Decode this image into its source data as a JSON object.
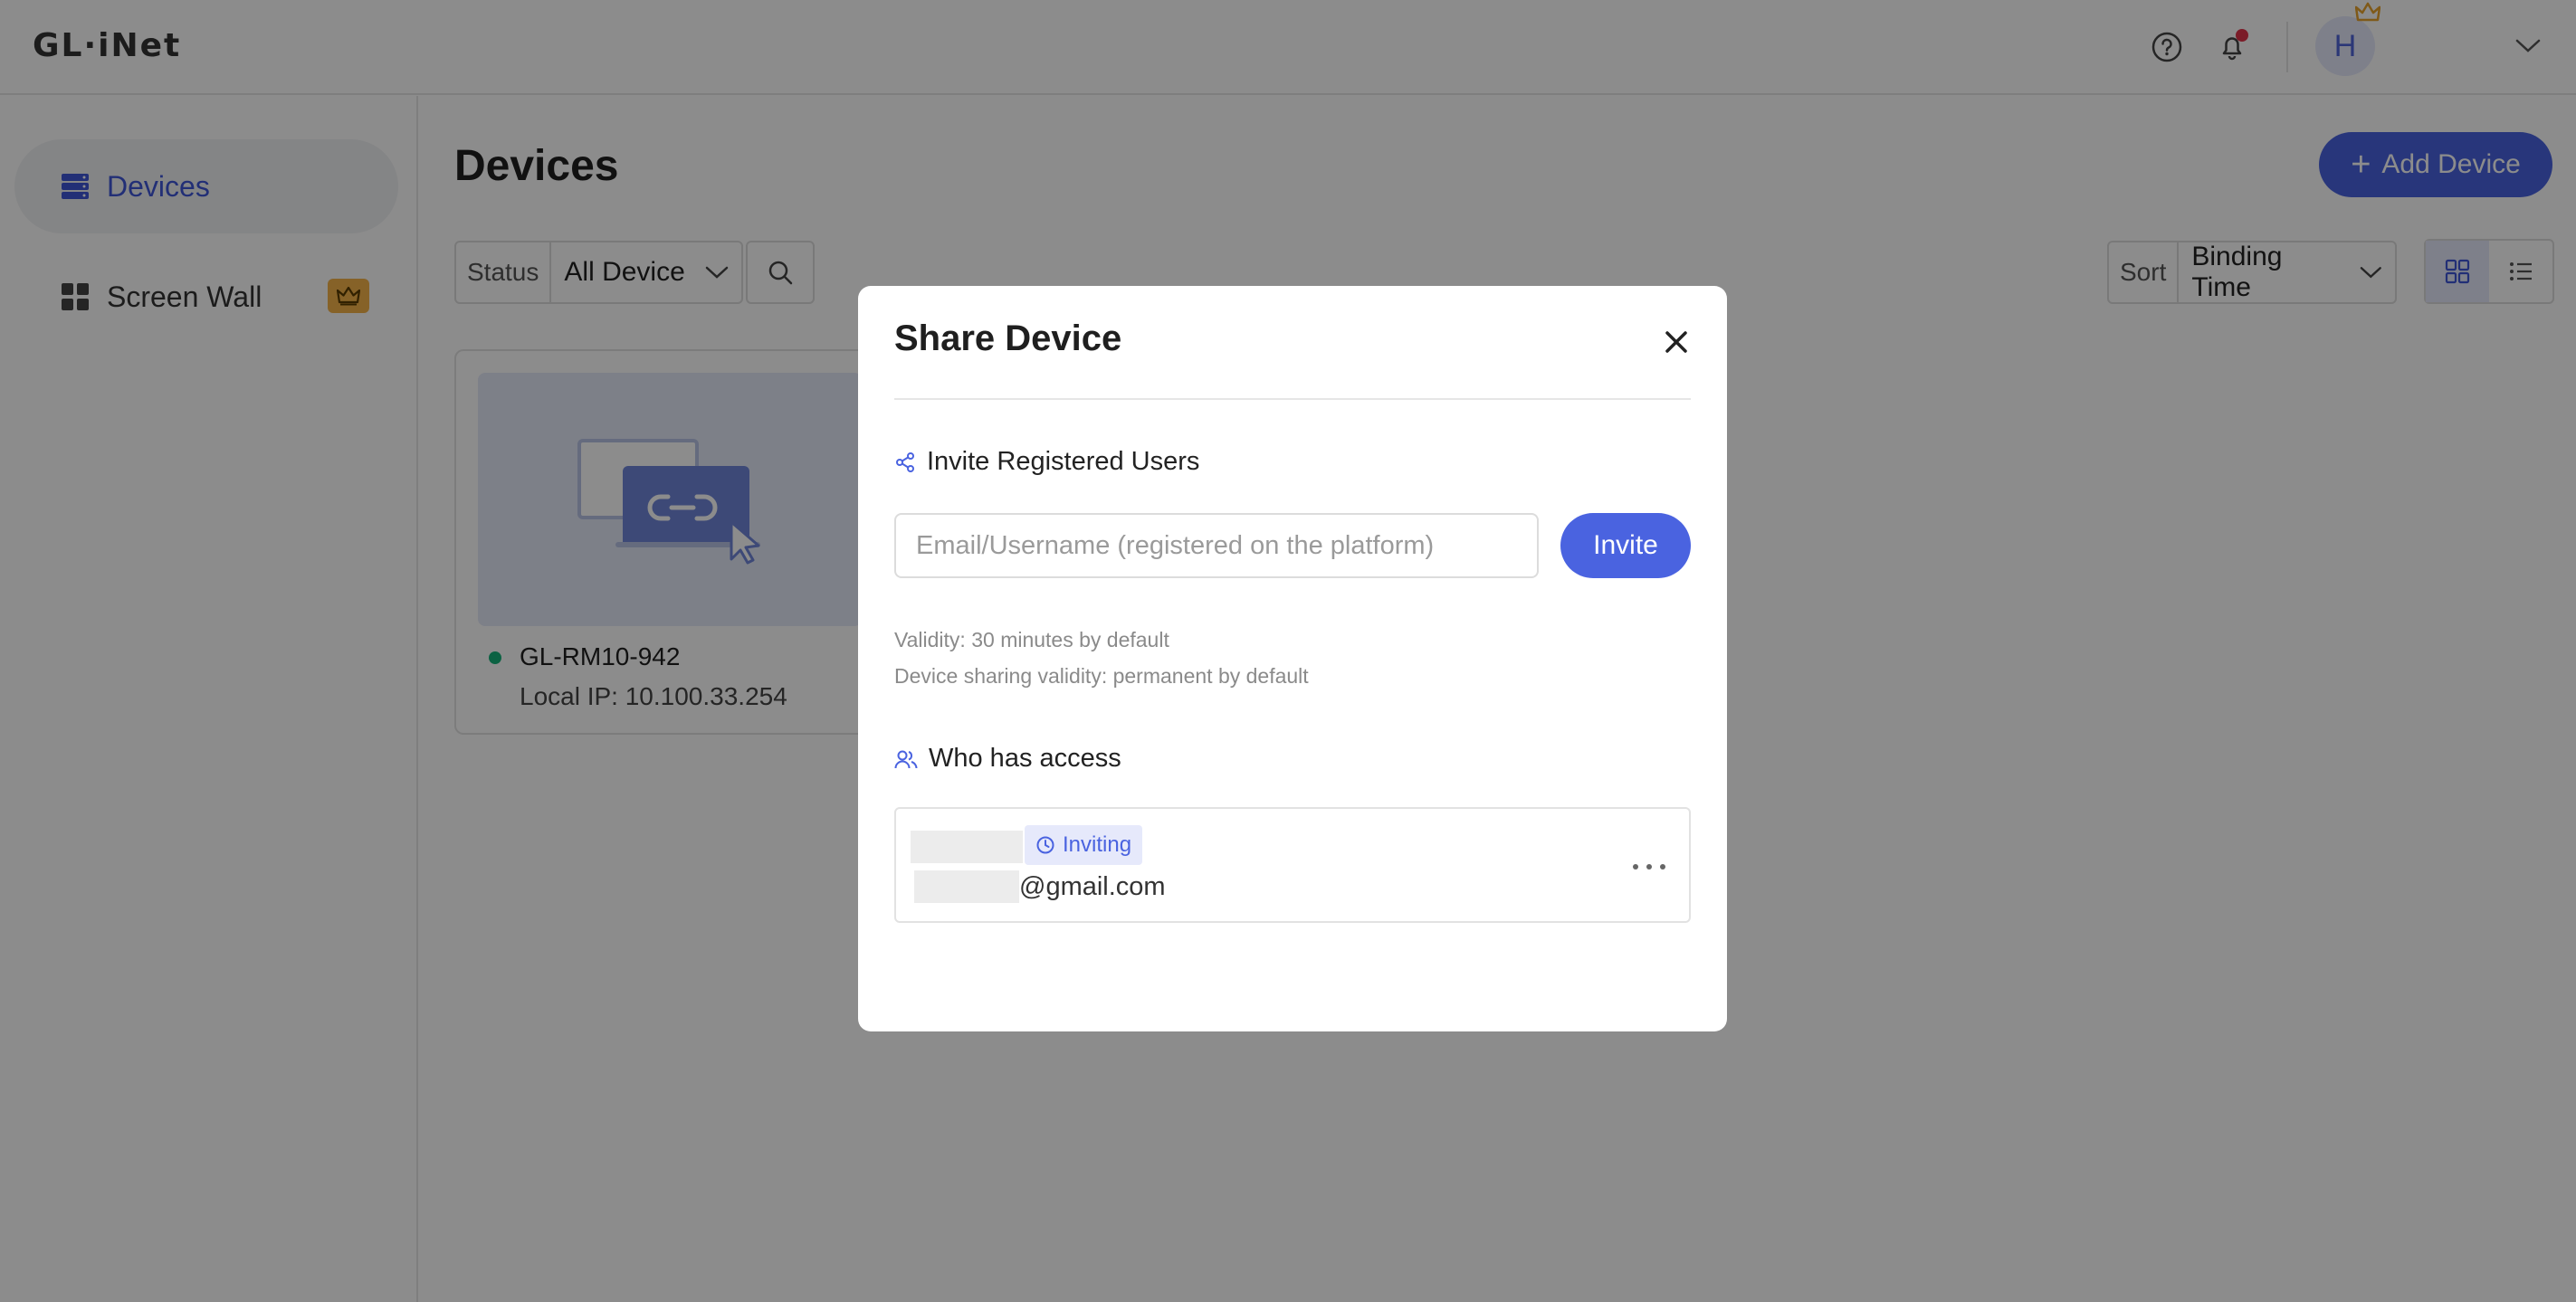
{
  "header": {
    "logo_text": "GL·iNet",
    "avatar_initial": "H",
    "icons": [
      "help-icon",
      "bell-icon",
      "crown-icon",
      "chevron-down-icon"
    ],
    "notification_dot_color": "#e0334a"
  },
  "sidebar": {
    "items": [
      {
        "label": "Devices",
        "icon": "server-icon",
        "active": true
      },
      {
        "label": "Screen Wall",
        "icon": "grid-icon",
        "badge_icon": "crown-icon"
      }
    ]
  },
  "main": {
    "title": "Devices",
    "add_button": "Add Device",
    "filter": {
      "label": "Status",
      "value": "All Device"
    },
    "sort": {
      "label": "Sort",
      "value": "Binding Time"
    },
    "view_modes": [
      "grid-view-icon",
      "list-view-icon"
    ],
    "devices": [
      {
        "name": "GL-RM10-942",
        "ip": "Local IP: 10.100.33.254",
        "online": true
      }
    ]
  },
  "modal": {
    "title": "Share Device",
    "invite_section": "Invite Registered Users",
    "input_placeholder": "Email/Username (registered on the platform)",
    "invite_button": "Invite",
    "note_validity": "Validity: 30 minutes by default",
    "note_sharing": "Device sharing validity: permanent by default",
    "access_section": "Who has access",
    "access_list": [
      {
        "status": "Inviting",
        "email": "@gmail.com"
      }
    ]
  },
  "colors": {
    "accent": "#4a63e0",
    "online": "#17b37a",
    "vip": "#f4b24a"
  }
}
